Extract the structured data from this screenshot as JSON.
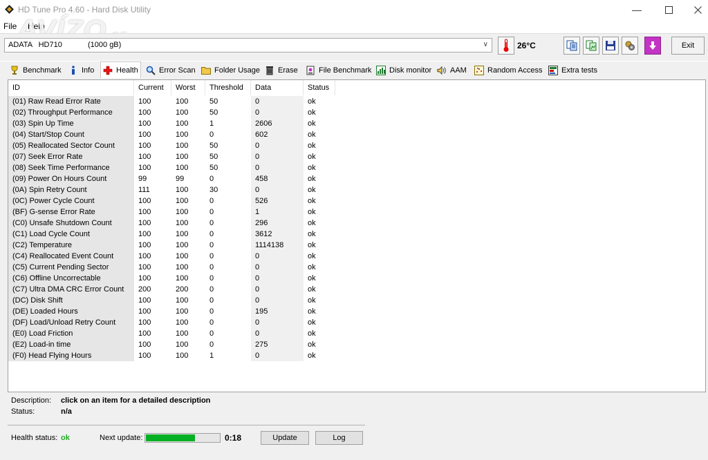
{
  "window": {
    "title": "HD Tune Pro 4.60 - Hard Disk Utility"
  },
  "watermark": {
    "text": "AVÍZO",
    "suffix": ".cz"
  },
  "menu": {
    "file": "File",
    "help": "Help"
  },
  "toolbar": {
    "drive_name": "ADATA   HD710",
    "drive_size": "(1000 gB)",
    "temperature": "26°C",
    "exit_label": "Exit"
  },
  "tabs": [
    {
      "label": "Benchmark",
      "icon": "benchmark-icon"
    },
    {
      "label": "Info",
      "icon": "info-icon"
    },
    {
      "label": "Health",
      "icon": "health-cross-icon"
    },
    {
      "label": "Error Scan",
      "icon": "magnifier-icon"
    },
    {
      "label": "Folder Usage",
      "icon": "folder-icon"
    },
    {
      "label": "Erase",
      "icon": "trash-icon"
    },
    {
      "label": "File Benchmark",
      "icon": "file-benchmark-icon"
    },
    {
      "label": "Disk monitor",
      "icon": "disk-monitor-icon"
    },
    {
      "label": "AAM",
      "icon": "speaker-icon"
    },
    {
      "label": "Random Access",
      "icon": "random-access-icon"
    },
    {
      "label": "Extra tests",
      "icon": "extra-tests-icon"
    }
  ],
  "active_tab": "Health",
  "table": {
    "headers": [
      "ID",
      "Current",
      "Worst",
      "Threshold",
      "Data",
      "Status"
    ],
    "rows": [
      [
        "(01) Raw Read Error Rate",
        "100",
        "100",
        "50",
        "0",
        "ok"
      ],
      [
        "(02) Throughput Performance",
        "100",
        "100",
        "50",
        "0",
        "ok"
      ],
      [
        "(03) Spin Up Time",
        "100",
        "100",
        "1",
        "2606",
        "ok"
      ],
      [
        "(04) Start/Stop Count",
        "100",
        "100",
        "0",
        "602",
        "ok"
      ],
      [
        "(05) Reallocated Sector Count",
        "100",
        "100",
        "50",
        "0",
        "ok"
      ],
      [
        "(07) Seek Error Rate",
        "100",
        "100",
        "50",
        "0",
        "ok"
      ],
      [
        "(08) Seek Time Performance",
        "100",
        "100",
        "50",
        "0",
        "ok"
      ],
      [
        "(09) Power On Hours Count",
        "99",
        "99",
        "0",
        "458",
        "ok"
      ],
      [
        "(0A) Spin Retry Count",
        "111",
        "100",
        "30",
        "0",
        "ok"
      ],
      [
        "(0C) Power Cycle Count",
        "100",
        "100",
        "0",
        "526",
        "ok"
      ],
      [
        "(BF) G-sense Error Rate",
        "100",
        "100",
        "0",
        "1",
        "ok"
      ],
      [
        "(C0) Unsafe Shutdown Count",
        "100",
        "100",
        "0",
        "296",
        "ok"
      ],
      [
        "(C1) Load Cycle Count",
        "100",
        "100",
        "0",
        "3612",
        "ok"
      ],
      [
        "(C2) Temperature",
        "100",
        "100",
        "0",
        "1114138",
        "ok"
      ],
      [
        "(C4) Reallocated Event Count",
        "100",
        "100",
        "0",
        "0",
        "ok"
      ],
      [
        "(C5) Current Pending Sector",
        "100",
        "100",
        "0",
        "0",
        "ok"
      ],
      [
        "(C6) Offline Uncorrectable",
        "100",
        "100",
        "0",
        "0",
        "ok"
      ],
      [
        "(C7) Ultra DMA CRC Error Count",
        "200",
        "200",
        "0",
        "0",
        "ok"
      ],
      [
        "(DC) Disk Shift",
        "100",
        "100",
        "0",
        "0",
        "ok"
      ],
      [
        "(DE) Loaded Hours",
        "100",
        "100",
        "0",
        "195",
        "ok"
      ],
      [
        "(DF) Load/Unload Retry Count",
        "100",
        "100",
        "0",
        "0",
        "ok"
      ],
      [
        "(E0) Load Friction",
        "100",
        "100",
        "0",
        "0",
        "ok"
      ],
      [
        "(E2) Load-in time",
        "100",
        "100",
        "0",
        "275",
        "ok"
      ],
      [
        "(F0) Head Flying Hours",
        "100",
        "100",
        "1",
        "0",
        "ok"
      ]
    ]
  },
  "description": {
    "label": "Description:",
    "value": "click on an item for a detailed description",
    "status_label": "Status:",
    "status_value": "n/a"
  },
  "footer": {
    "health_label": "Health status:",
    "health_value": "ok",
    "health_color": "#22aa22",
    "next_update_label": "Next update:",
    "next_update_progress": 0.68,
    "next_update_time": "0:18",
    "update_button": "Update",
    "log_button": "Log"
  }
}
